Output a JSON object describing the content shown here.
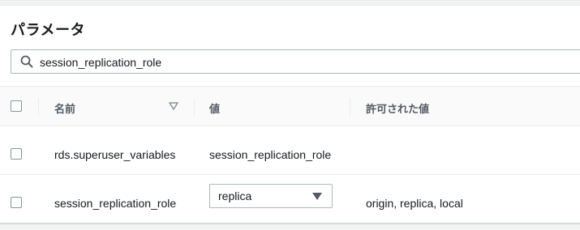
{
  "panel": {
    "title": "パラメータ"
  },
  "search": {
    "value": "session_replication_role"
  },
  "table": {
    "columns": [
      "名前",
      "値",
      "許可された値"
    ],
    "rows": [
      {
        "name": "rds.superuser_variables",
        "value": "session_replication_role",
        "allowed": ""
      },
      {
        "name": "session_replication_role",
        "value": "replica",
        "allowed": "origin, replica, local"
      }
    ]
  },
  "icons": {
    "search": "search-icon",
    "sort": "sort-down-icon",
    "dropdown": "caret-down-icon"
  },
  "colors": {
    "text": "#16191f",
    "header_text": "#545b64",
    "border": "#aab7b8",
    "header_bg": "#fafafa"
  }
}
